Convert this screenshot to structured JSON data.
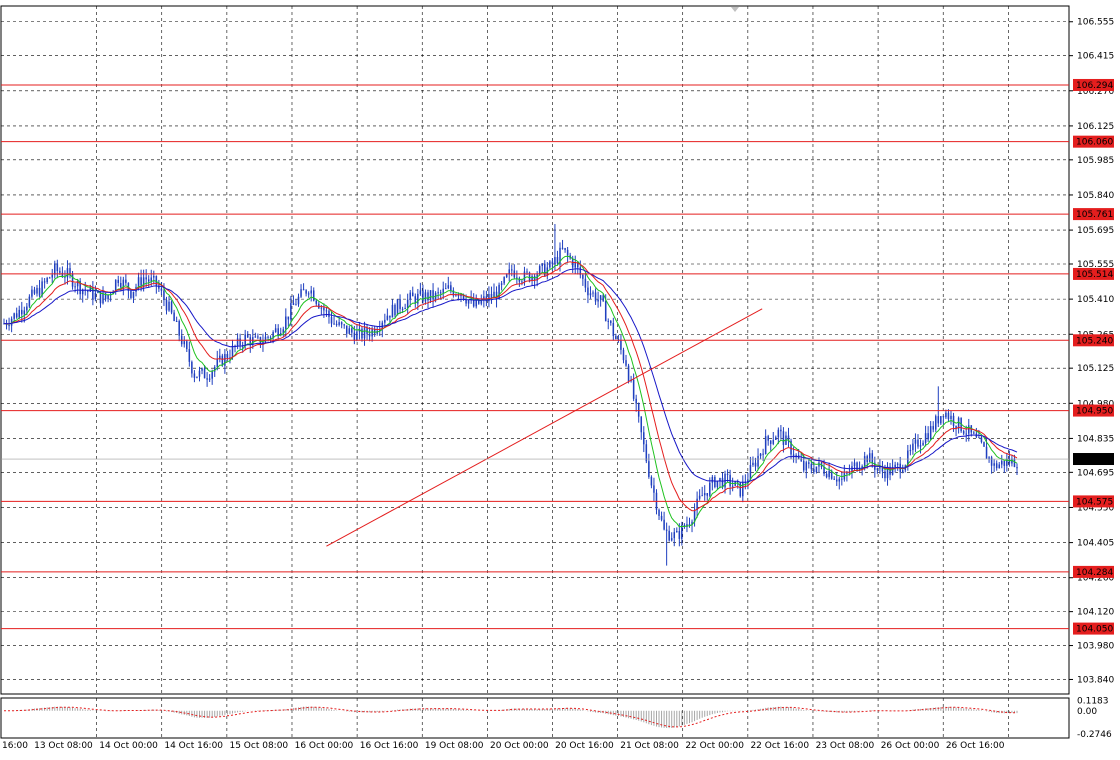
{
  "chart_data": {
    "type": "candlestick",
    "title": "",
    "symbol_current_price": "104.750",
    "y_axis": {
      "ylim": [
        103.78,
        106.62
      ],
      "ticks": [
        "106.555",
        "106.415",
        "106.270",
        "106.125",
        "105.985",
        "105.840",
        "105.695",
        "105.555",
        "105.410",
        "105.265",
        "105.125",
        "104.980",
        "104.835",
        "104.695",
        "104.550",
        "104.405",
        "104.260",
        "104.120",
        "103.980",
        "103.840"
      ]
    },
    "x_axis": {
      "ticks": [
        "16:00",
        "13 Oct 08:00",
        "14 Oct 00:00",
        "14 Oct 16:00",
        "15 Oct 08:00",
        "16 Oct 00:00",
        "16 Oct 16:00",
        "19 Oct 08:00",
        "20 Oct 00:00",
        "20 Oct 16:00",
        "21 Oct 08:00",
        "22 Oct 00:00",
        "22 Oct 16:00",
        "23 Oct 08:00",
        "26 Oct 00:00",
        "26 Oct 16:00"
      ]
    },
    "horizontal_levels": [
      "106.294",
      "106.060",
      "105.761",
      "105.514",
      "105.240",
      "104.950",
      "104.575",
      "104.284",
      "104.050"
    ],
    "trend_line": {
      "from_index": 127,
      "from_price": 104.39,
      "to_index": 215,
      "to_price": 104.88
    },
    "colors": {
      "candle": "#1f3fbf",
      "level": "#e41e1e",
      "ma_fast": "#1ec21e",
      "ma_mid": "#e41e1e",
      "ma_slow": "#1818c8",
      "oscillator_signal": "#e41e1e",
      "oscillator_hist": "#a6a6a6",
      "grid": "#000000"
    },
    "candles_anchor": [
      [
        0,
        105.31
      ],
      [
        5,
        105.35
      ],
      [
        10,
        105.41
      ],
      [
        15,
        105.46
      ],
      [
        20,
        105.53
      ],
      [
        25,
        105.51
      ],
      [
        30,
        105.46
      ],
      [
        35,
        105.43
      ],
      [
        40,
        105.41
      ],
      [
        45,
        105.5
      ],
      [
        50,
        105.44
      ],
      [
        55,
        105.5
      ],
      [
        60,
        105.47
      ],
      [
        65,
        105.37
      ],
      [
        70,
        105.24
      ],
      [
        75,
        105.1
      ],
      [
        80,
        105.1
      ],
      [
        85,
        105.15
      ],
      [
        90,
        105.2
      ],
      [
        95,
        105.25
      ],
      [
        100,
        105.23
      ],
      [
        105,
        105.26
      ],
      [
        110,
        105.31
      ],
      [
        115,
        105.4
      ],
      [
        120,
        105.46
      ],
      [
        125,
        105.38
      ],
      [
        130,
        105.31
      ],
      [
        135,
        105.28
      ],
      [
        140,
        105.26
      ],
      [
        145,
        105.28
      ],
      [
        150,
        105.34
      ],
      [
        155,
        105.38
      ],
      [
        160,
        105.41
      ],
      [
        165,
        105.42
      ],
      [
        170,
        105.42
      ],
      [
        175,
        105.45
      ],
      [
        180,
        105.44
      ],
      [
        185,
        105.38
      ],
      [
        190,
        105.41
      ],
      [
        195,
        105.44
      ],
      [
        200,
        105.53
      ],
      [
        205,
        105.5
      ],
      [
        210,
        105.52
      ],
      [
        215,
        105.54
      ],
      [
        220,
        105.61
      ],
      [
        225,
        105.55
      ],
      [
        230,
        105.45
      ],
      [
        235,
        105.4
      ],
      [
        240,
        105.27
      ],
      [
        245,
        105.15
      ],
      [
        250,
        104.9
      ],
      [
        255,
        104.65
      ],
      [
        260,
        104.45
      ],
      [
        265,
        104.43
      ],
      [
        270,
        104.5
      ],
      [
        275,
        104.6
      ],
      [
        280,
        104.66
      ],
      [
        285,
        104.66
      ],
      [
        290,
        104.62
      ],
      [
        295,
        104.72
      ],
      [
        300,
        104.82
      ],
      [
        305,
        104.86
      ],
      [
        310,
        104.79
      ],
      [
        315,
        104.71
      ],
      [
        320,
        104.72
      ],
      [
        325,
        104.7
      ],
      [
        330,
        104.66
      ],
      [
        335,
        104.72
      ],
      [
        340,
        104.76
      ],
      [
        345,
        104.7
      ],
      [
        350,
        104.7
      ],
      [
        355,
        104.74
      ],
      [
        360,
        104.82
      ],
      [
        365,
        104.87
      ],
      [
        370,
        104.95
      ],
      [
        375,
        104.9
      ],
      [
        380,
        104.86
      ],
      [
        385,
        104.8
      ],
      [
        390,
        104.72
      ],
      [
        395,
        104.74
      ]
    ],
    "oscillator": {
      "ticks": [
        "0.1183",
        "0.00",
        "-0.2746"
      ],
      "ylim": [
        -0.32,
        0.15
      ]
    }
  }
}
